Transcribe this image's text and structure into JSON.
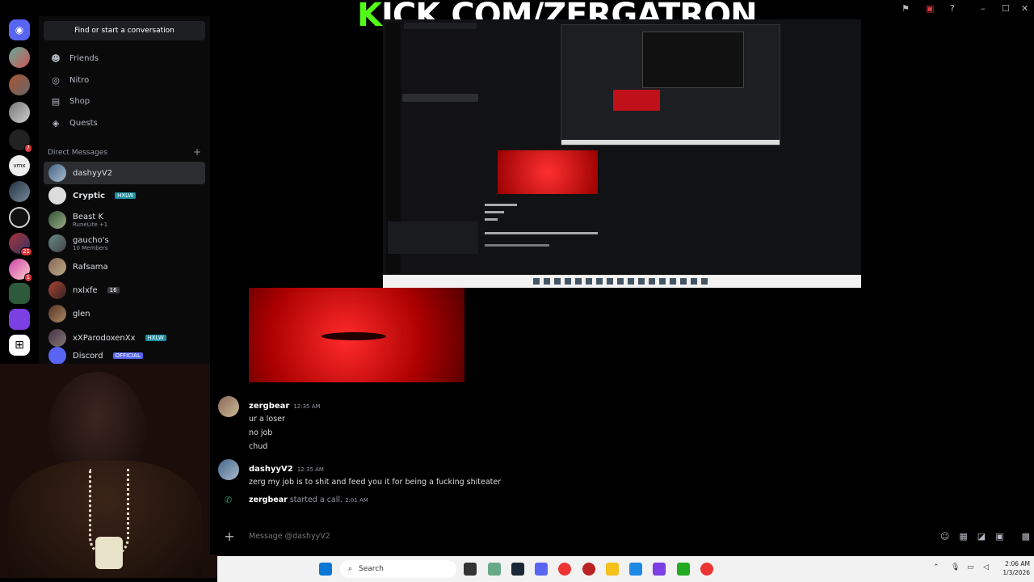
{
  "banner": {
    "k": "K",
    "rest": "ICK.COM/ZERGATRON"
  },
  "sidebar": {
    "find": "Find or start a conversation",
    "nav": [
      {
        "label": "Friends",
        "icon": "friends-icon"
      },
      {
        "label": "Nitro",
        "icon": "nitro-icon"
      },
      {
        "label": "Shop",
        "icon": "shop-icon"
      },
      {
        "label": "Quests",
        "icon": "quests-icon"
      }
    ],
    "dm_header": "Direct Messages",
    "dm_add": "+",
    "dms": [
      {
        "name": "dashyyV2",
        "sub": "",
        "tag": ""
      },
      {
        "name": "Cryptic",
        "sub": "",
        "tag": "HXLW"
      },
      {
        "name": "Beast K",
        "sub": "RuneLite +1",
        "tag": ""
      },
      {
        "name": "gaucho's",
        "sub": "10 Members",
        "tag": ""
      },
      {
        "name": "Rafsama",
        "sub": "",
        "tag": ""
      },
      {
        "name": "nxlxfe",
        "sub": "",
        "tag": "16"
      },
      {
        "name": "glen",
        "sub": "",
        "tag": ""
      },
      {
        "name": "xXParodoxenXx",
        "sub": "",
        "tag": "HXLW"
      },
      {
        "name": "Discord",
        "sub": "",
        "tag": "OFFICIAL"
      }
    ]
  },
  "servers": {
    "badges": [
      "7",
      "21",
      "1"
    ]
  },
  "chat": {
    "messages": [
      {
        "user": "zergbear",
        "time": "12:35 AM",
        "lines": [
          "ur a loser",
          "no job",
          "chud"
        ]
      },
      {
        "user": "dashyyV2",
        "time": "12:35 AM",
        "lines": [
          "zerg my job is to shit and feed you it for being a fucking shiteater"
        ]
      }
    ],
    "call": {
      "user": "zergbear",
      "text": "started a call.",
      "time": "2:01 AM"
    },
    "input_placeholder": "Message @dashyyV2"
  },
  "taskbar": {
    "search": "Search",
    "time": "2:06 AM",
    "date": "1/3/2026"
  },
  "colors": {
    "kick_green": "#53fc18",
    "discord_blurple": "#5865f2",
    "red": "#e0141a"
  }
}
